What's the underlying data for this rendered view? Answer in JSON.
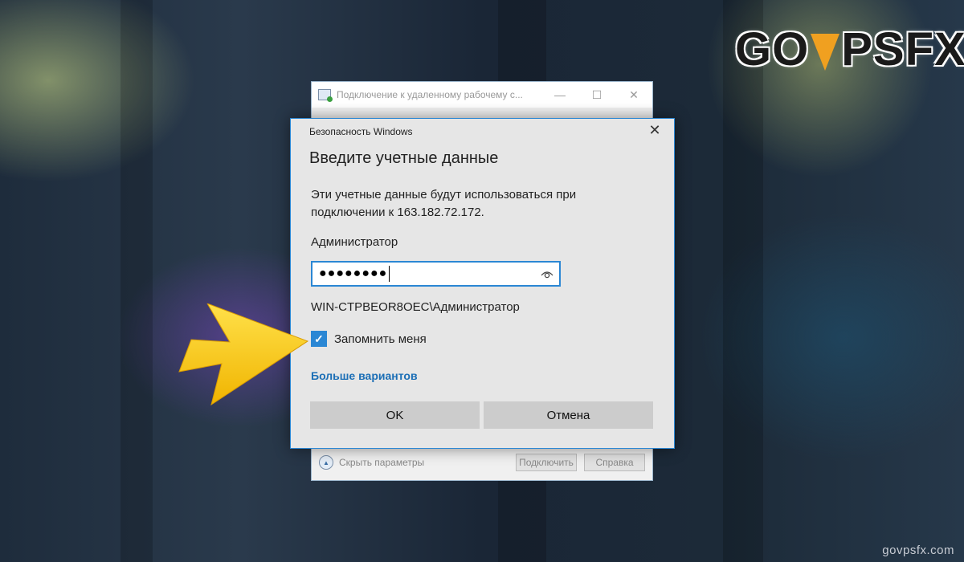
{
  "logo": {
    "left": "GO",
    "right": "PSFX"
  },
  "watermark": "govpsfx.com",
  "rdp_window": {
    "title": "Подключение к удаленному рабочему с...",
    "minimize": "—",
    "maximize": "☐",
    "close": "✕",
    "hide_options": "Скрыть параметры",
    "connect_button": "Подключить",
    "help_button": "Справка"
  },
  "security_dialog": {
    "window_title": "Безопасность Windows",
    "close": "✕",
    "heading": "Введите учетные данные",
    "description": "Эти учетные данные будут использоваться при подключении к 163.182.72.172.",
    "username": "Администратор",
    "password_value": "●●●●●●●●",
    "domain_user": "WIN-CTPBEOR8OEC\\Администратор",
    "remember_label": "Запомнить меня",
    "remember_checked": true,
    "more_options": "Больше вариантов",
    "ok_button": "OK",
    "cancel_button": "Отмена"
  },
  "colors": {
    "accent": "#2b87d4",
    "link": "#1c6fb6",
    "arrow": "#f5c800",
    "logo_mark": "#f0a020"
  }
}
